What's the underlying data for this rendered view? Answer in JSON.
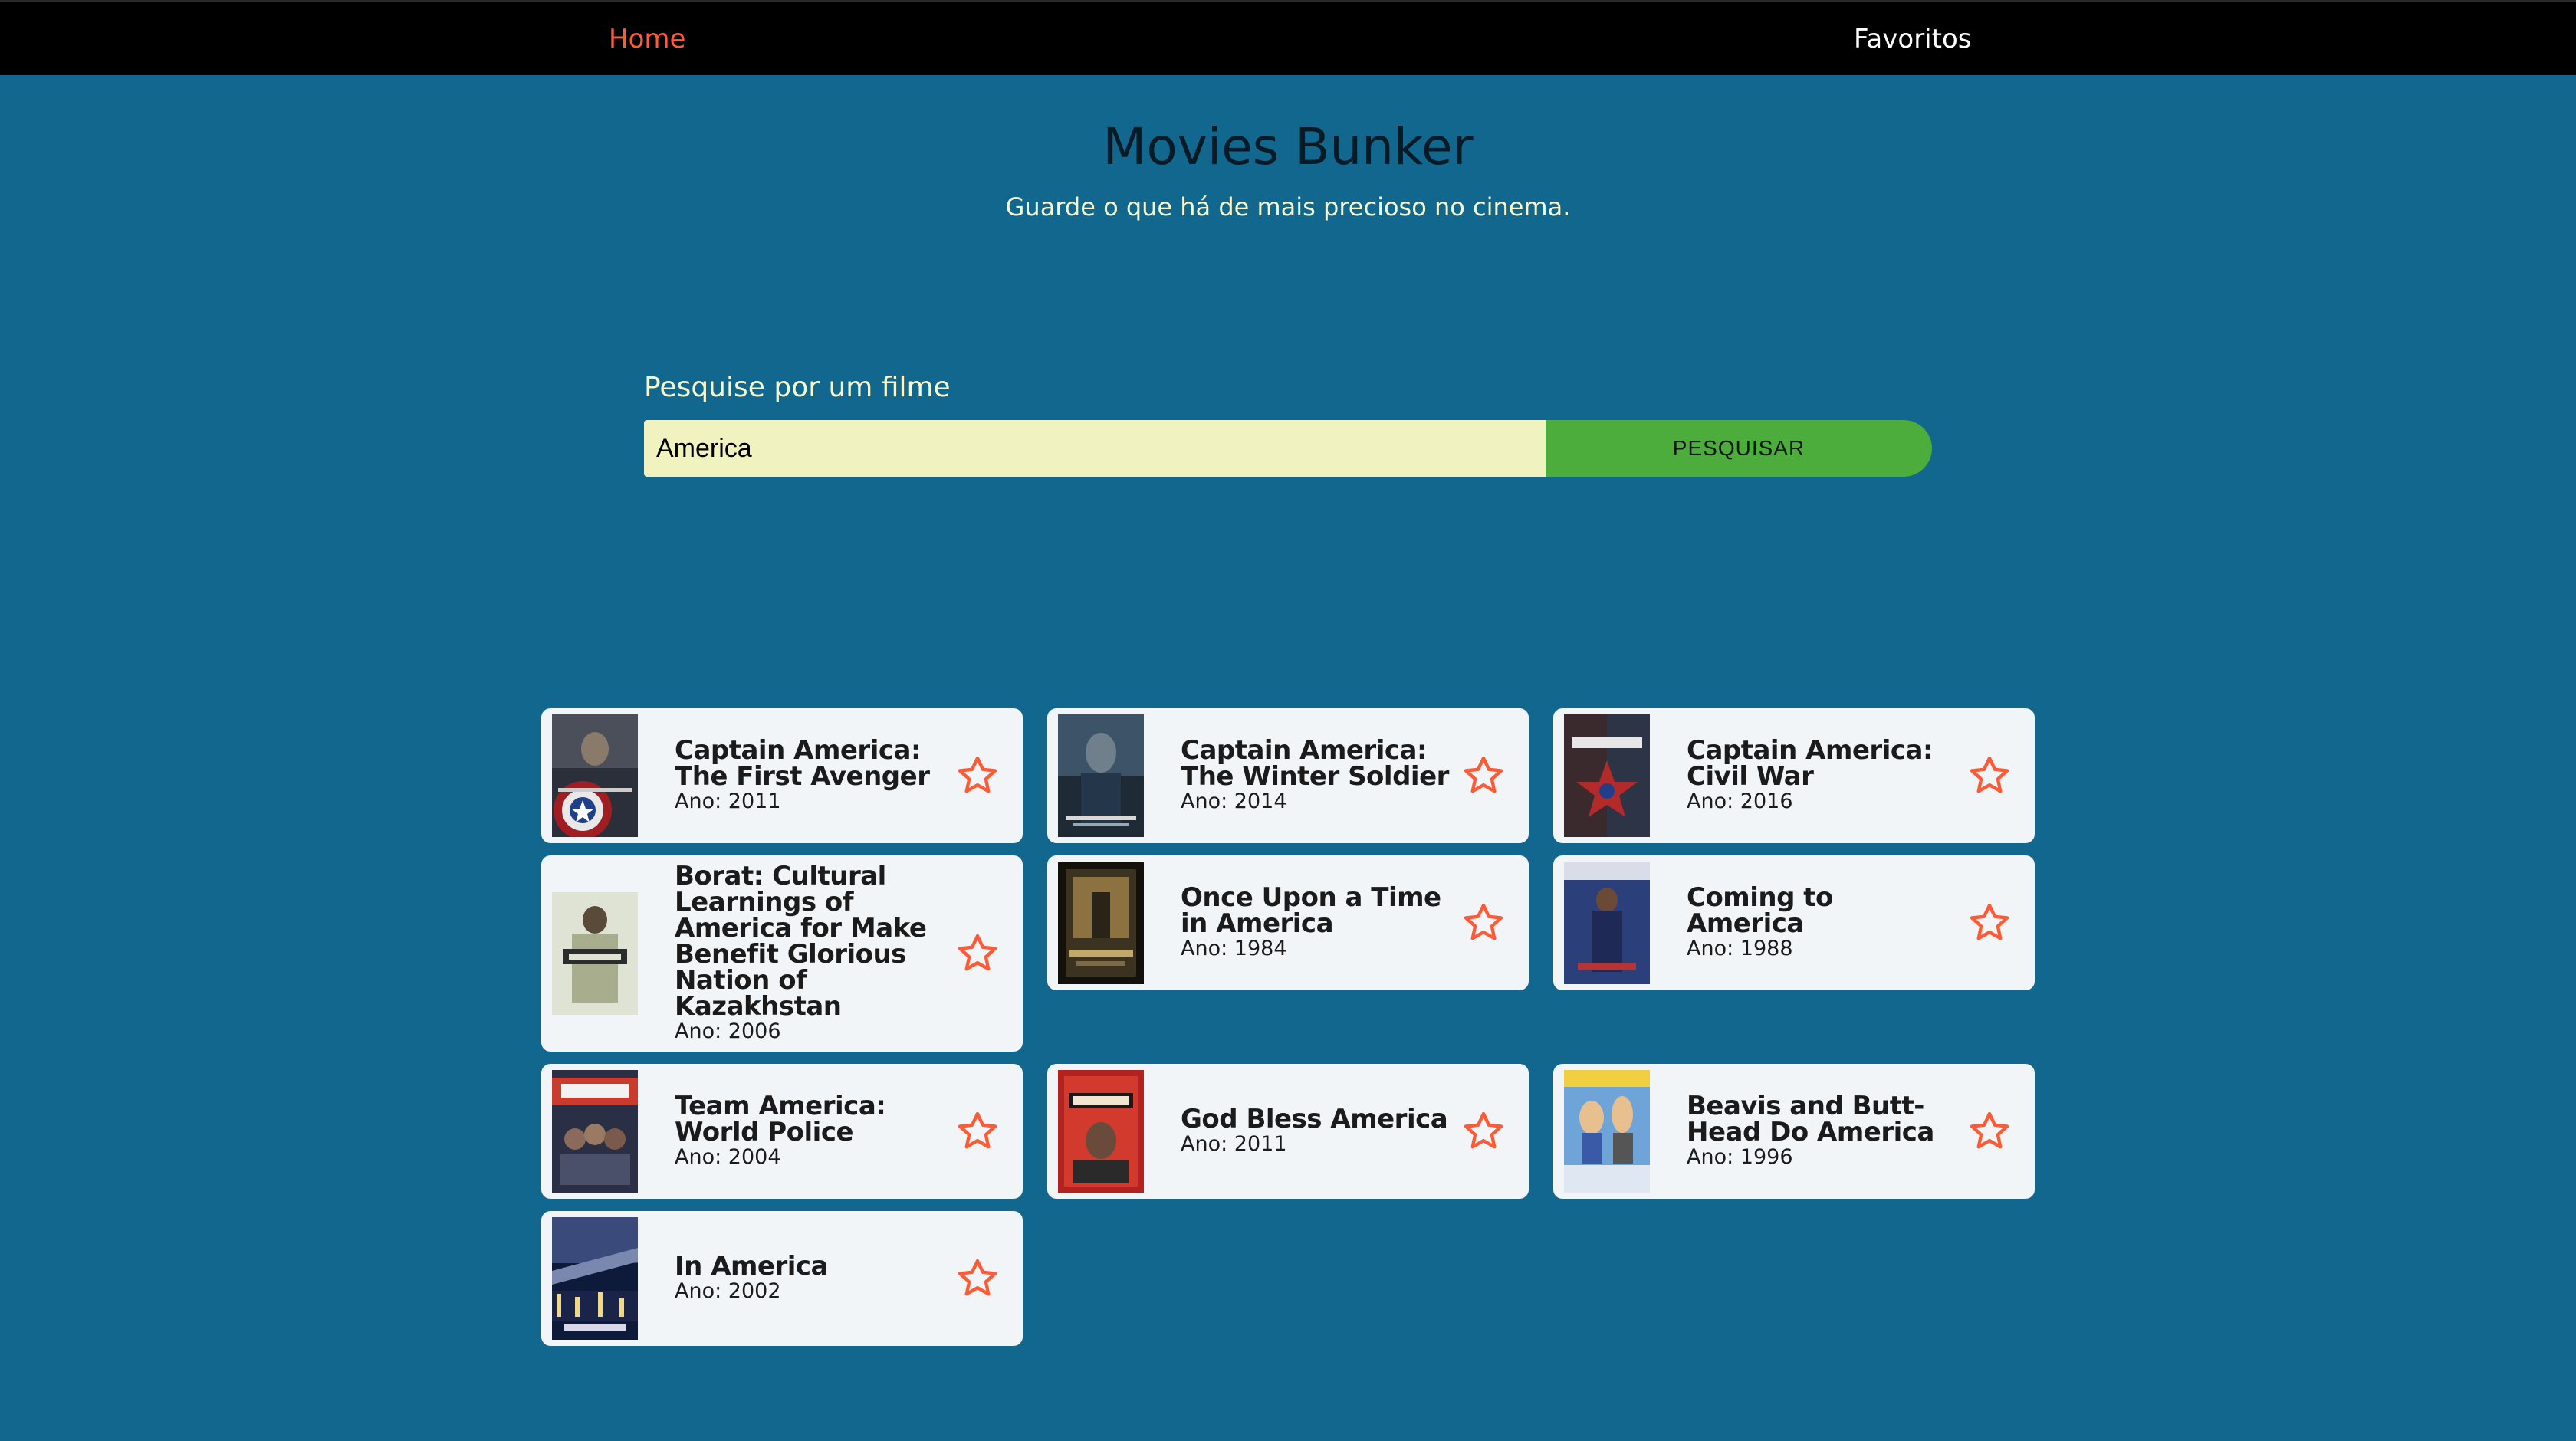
{
  "nav": {
    "home_label": "Home",
    "favorites_label": "Favoritos"
  },
  "header": {
    "title": "Movies Bunker",
    "subtitle": "Guarde o que há de mais precioso no cinema."
  },
  "search": {
    "label": "Pesquise por um filme",
    "value": "America",
    "button_label": "PESQUISAR"
  },
  "results": [
    {
      "title": "Captain America: The First Avenger",
      "year": "Ano: 2011"
    },
    {
      "title": "Captain America: The Winter Soldier",
      "year": "Ano: 2014"
    },
    {
      "title": "Captain America: Civil War",
      "year": "Ano: 2016"
    },
    {
      "title": "Borat: Cultural Learnings of America for Make Benefit Glorious Nation of Kazakhstan",
      "year": "Ano: 2006"
    },
    {
      "title": "Once Upon a Time in America",
      "year": "Ano: 1984"
    },
    {
      "title": "Coming to America",
      "year": "Ano: 1988"
    },
    {
      "title": "Team America: World Police",
      "year": "Ano: 2004"
    },
    {
      "title": "God Bless America",
      "year": "Ano: 2011"
    },
    {
      "title": "Beavis and Butt-Head Do America",
      "year": "Ano: 1996"
    },
    {
      "title": "In America",
      "year": "Ano: 2002"
    }
  ],
  "icons": {
    "favorite": "star-outline-icon"
  },
  "colors": {
    "page_background": "#11678d",
    "nav_background": "#000000",
    "nav_active": "#ff5a36",
    "input_background": "#f0f2c0",
    "button_background": "#4dad3c",
    "card_background": "#f2f5f8",
    "star": "#ff5a36"
  }
}
